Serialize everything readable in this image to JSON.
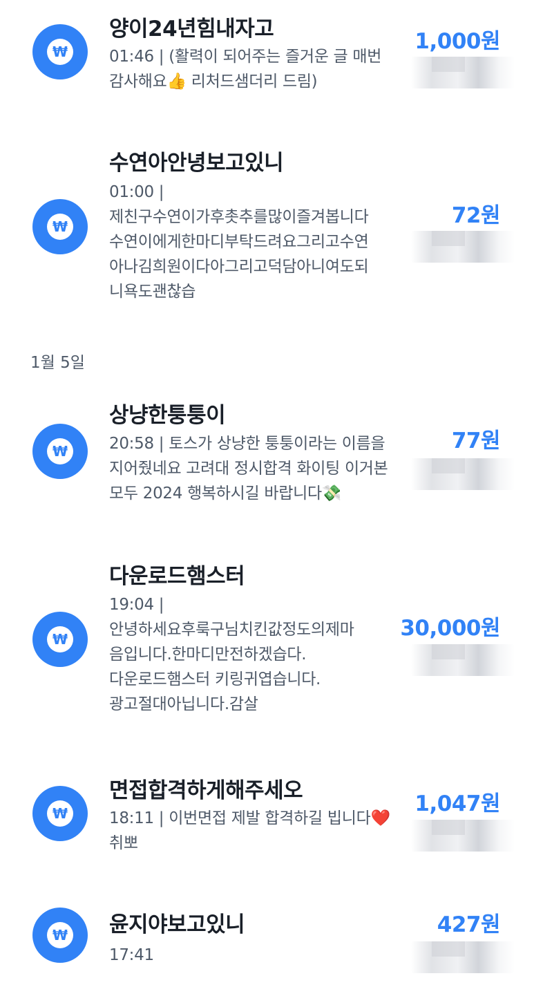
{
  "brand_color": "#3182f6",
  "icon": "won-coin-icon",
  "sections": [
    {
      "date_label": "",
      "items": [
        {
          "title": "양이24년힘내자고",
          "amount": "1,000원",
          "detail_lines": [
            "01:46 | (활력이 되어주는 즐거운 글 매번",
            "감사해요👍 리처드샘더리 드림)"
          ]
        },
        {
          "title": "수연아안녕보고있니",
          "amount": "72원",
          "detail_lines": [
            "01:00 |",
            "제친구수연이가후촛추를많이즐겨봅니다",
            "수연이에게한마디부탁드려요그리고수연",
            "아나김희원이다아그리고덕담아니여도되",
            "니욕도괜찮습"
          ]
        }
      ]
    },
    {
      "date_label": "1월 5일",
      "items": [
        {
          "title": "상냥한퉁퉁이",
          "amount": "77원",
          "detail_lines": [
            "20:58 | 토스가 상냥한 퉁퉁이라는 이름을",
            "지어줬네요 고려대 정시합격 화이팅 이거본",
            "모두 2024 행복하시길 바랍니다💸"
          ]
        },
        {
          "title": "다운로드햄스터",
          "amount": "30,000원",
          "detail_lines": [
            "19:04 |",
            "안녕하세요후룩구님치킨값정도의제마",
            "음입니다.한마디만전하겠습다.",
            "다운로드햄스터 키링귀엽습니다.",
            "광고절대아닙니다.감살"
          ]
        },
        {
          "title": "면접합격하게해주세오",
          "amount": "1,047원",
          "detail_lines": [
            "18:11 | 이번면접 제발 합격하길 빕니다❤️",
            "취뽀"
          ]
        },
        {
          "title": "윤지야보고있니",
          "amount": "427원",
          "detail_lines": [
            "17:41"
          ]
        }
      ]
    }
  ]
}
